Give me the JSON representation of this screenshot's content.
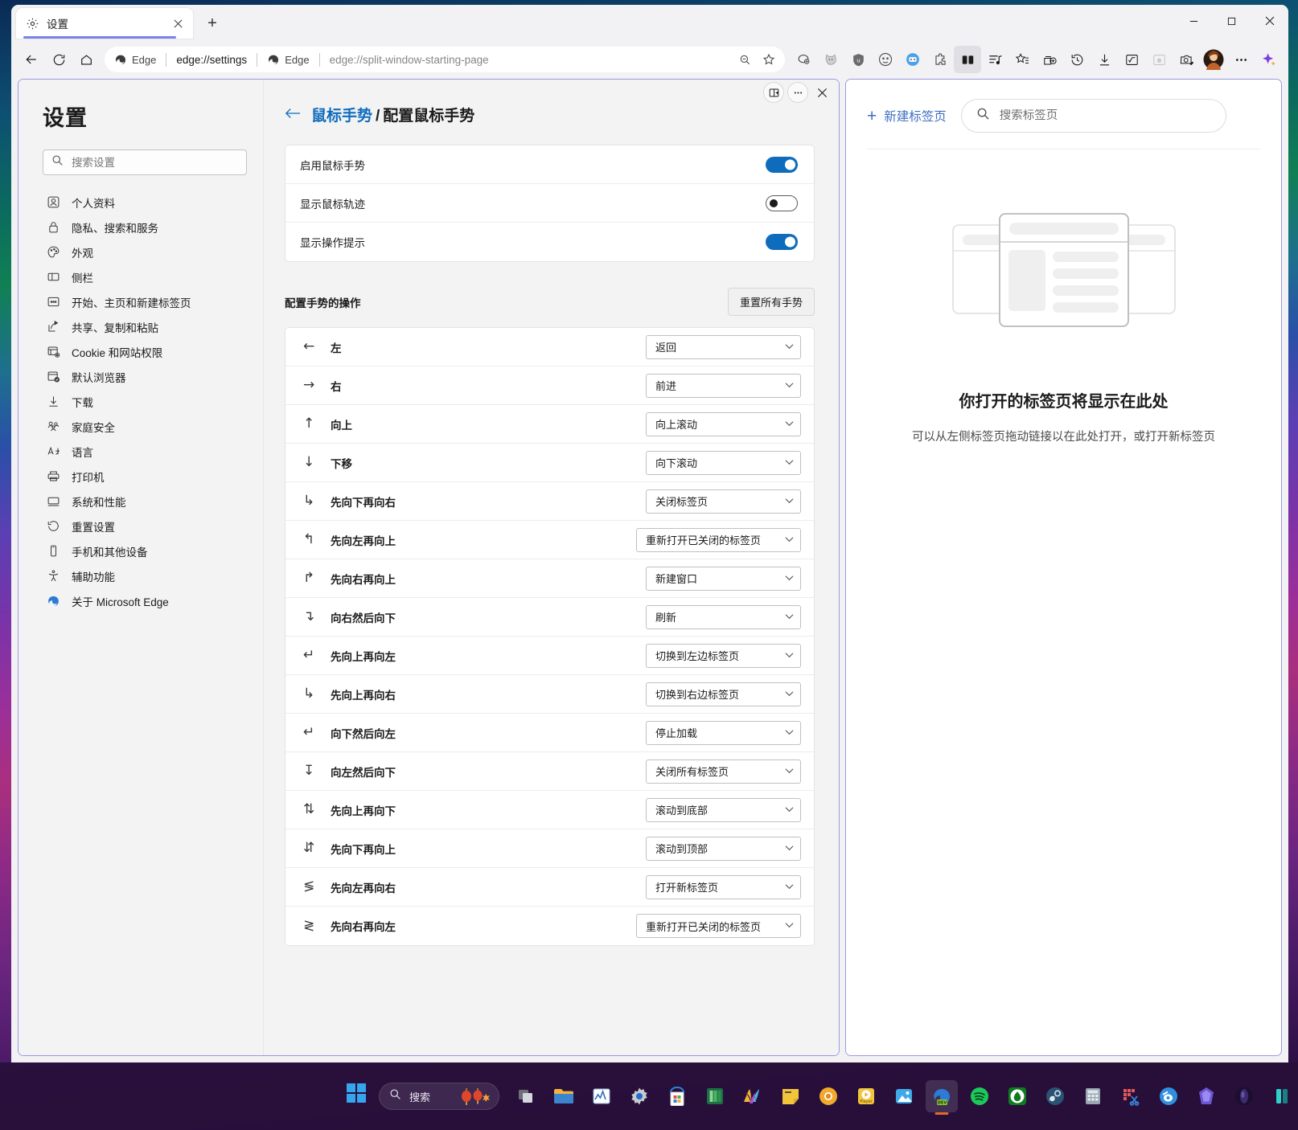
{
  "browser": {
    "tab": {
      "title": "设置",
      "favicon_icon": "gear-icon",
      "close_icon": "close-icon"
    },
    "new_tab_icon": "plus-icon",
    "window_controls": {
      "minimize": "minimize-icon",
      "maximize": "maximize-icon",
      "close": "close-icon"
    },
    "nav": {
      "back_icon": "back-arrow-icon",
      "refresh_icon": "refresh-icon",
      "home_icon": "home-icon"
    },
    "address": {
      "left_badge": "Edge",
      "left_url": "edge://settings",
      "right_badge": "Edge",
      "right_url": "edge://split-window-starting-page",
      "zoom_icon": "zoom-out-icon",
      "favorite_icon": "star-add-icon"
    },
    "toolbar_icons": [
      "copilot-badge-icon",
      "cat-extension-icon",
      "ublock-origin-icon",
      "monkey-extension-icon",
      "blue-robot-extension-icon",
      "puzzle-extensions-icon",
      "split-screen-icon",
      "playlist-icon",
      "collections-star-icon",
      "add-tab-group-icon",
      "history-icon",
      "downloads-icon",
      "math-solver-icon",
      "ie-mode-icon",
      "screenshot-icon",
      "profile-avatar",
      "more-settings-icon",
      "copilot-sparkle-icon"
    ]
  },
  "split_controls": {
    "layout_icon": "split-layout-icon",
    "more_icon": "more-dots-icon",
    "close_icon": "close-icon"
  },
  "settings": {
    "heading": "设置",
    "search": {
      "placeholder": "搜索设置",
      "value": "",
      "icon": "search-icon"
    },
    "nav_items": [
      {
        "label": "个人资料",
        "icon": "profile-icon"
      },
      {
        "label": "隐私、搜索和服务",
        "icon": "lock-icon"
      },
      {
        "label": "外观",
        "icon": "palette-icon"
      },
      {
        "label": "侧栏",
        "icon": "sidebar-icon"
      },
      {
        "label": "开始、主页和新建标签页",
        "icon": "home-page-icon"
      },
      {
        "label": "共享、复制和粘贴",
        "icon": "share-icon"
      },
      {
        "label": "Cookie 和网站权限",
        "icon": "cookie-permissions-icon"
      },
      {
        "label": "默认浏览器",
        "icon": "default-browser-icon"
      },
      {
        "label": "下载",
        "icon": "download-icon"
      },
      {
        "label": "家庭安全",
        "icon": "family-icon"
      },
      {
        "label": "语言",
        "icon": "language-icon"
      },
      {
        "label": "打印机",
        "icon": "printer-icon"
      },
      {
        "label": "系统和性能",
        "icon": "system-icon"
      },
      {
        "label": "重置设置",
        "icon": "reset-icon"
      },
      {
        "label": "手机和其他设备",
        "icon": "phone-icon"
      },
      {
        "label": "辅助功能",
        "icon": "accessibility-icon"
      },
      {
        "label": "关于 Microsoft Edge",
        "icon": "edge-logo-icon"
      }
    ],
    "breadcrumb": {
      "back_icon": "back-arrow-icon",
      "parent": "鼠标手势",
      "separator": "/",
      "current": "配置鼠标手势"
    },
    "toggles": [
      {
        "label": "启用鼠标手势",
        "state": "on"
      },
      {
        "label": "显示鼠标轨迹",
        "state": "off"
      },
      {
        "label": "显示操作提示",
        "state": "on"
      }
    ],
    "gestures_section": {
      "title": "配置手势的操作",
      "reset_button": "重置所有手势"
    },
    "gestures": [
      {
        "glyph": "←",
        "name": "左",
        "action": "返回"
      },
      {
        "glyph": "→",
        "name": "右",
        "action": "前进"
      },
      {
        "glyph": "↑",
        "name": "向上",
        "action": "向上滚动"
      },
      {
        "glyph": "↓",
        "name": "下移",
        "action": "向下滚动"
      },
      {
        "glyph": "↳",
        "name": "先向下再向右",
        "action": "关闭标签页"
      },
      {
        "glyph": "↰",
        "name": "先向左再向上",
        "action": "重新打开已关闭的标签页"
      },
      {
        "glyph": "↱",
        "name": "先向右再向上",
        "action": "新建窗口"
      },
      {
        "glyph": "↴",
        "name": "向右然后向下",
        "action": "刷新"
      },
      {
        "glyph": "↵",
        "name": "先向上再向左",
        "action": "切换到左边标签页"
      },
      {
        "glyph": "↳",
        "name": "先向上再向右",
        "action": "切换到右边标签页"
      },
      {
        "glyph": "↵",
        "name": "向下然后向左",
        "action": "停止加载"
      },
      {
        "glyph": "↧",
        "name": "向左然后向下",
        "action": "关闭所有标签页"
      },
      {
        "glyph": "⇅",
        "name": "先向上再向下",
        "action": "滚动到底部"
      },
      {
        "glyph": "⇵",
        "name": "先向下再向上",
        "action": "滚动到顶部"
      },
      {
        "glyph": "≶",
        "name": "先向左再向右",
        "action": "打开新标签页"
      },
      {
        "glyph": "≷",
        "name": "先向右再向左",
        "action": "重新打开已关闭的标签页"
      }
    ]
  },
  "split_page": {
    "new_tab_label": "新建标签页",
    "new_tab_icon": "plus-icon",
    "search": {
      "placeholder": "搜索标签页",
      "value": "",
      "icon": "search-icon"
    },
    "illustration_icon": "browser-windows-illustration",
    "title": "你打开的标签页将显示在此处",
    "subtitle": "可以从左侧标签页拖动链接以在此处打开，或打开新标签页"
  },
  "taskbar": {
    "start_icon": "windows-start-icon",
    "search": {
      "label": "搜索",
      "icon": "search-icon",
      "decoration": "lanterns-icon"
    },
    "apps": [
      {
        "icon": "task-view-icon"
      },
      {
        "icon": "file-explorer-icon"
      },
      {
        "icon": "performance-monitor-icon"
      },
      {
        "icon": "settings-gear-icon"
      },
      {
        "icon": "microsoft-store-icon"
      },
      {
        "icon": "excel-icon"
      },
      {
        "icon": "windows-mail-icon"
      },
      {
        "icon": "sticky-notes-icon"
      },
      {
        "icon": "chrome-icon"
      },
      {
        "icon": "media-player-icon"
      },
      {
        "icon": "photos-icon"
      },
      {
        "icon": "edge-dev-icon",
        "selected": true
      },
      {
        "icon": "spotify-icon"
      },
      {
        "icon": "xbox-icon"
      },
      {
        "icon": "steam-icon"
      },
      {
        "icon": "calculator-icon"
      },
      {
        "icon": "snipping-tool-icon"
      },
      {
        "icon": "blender-icon"
      },
      {
        "icon": "obsidian-icon"
      },
      {
        "icon": "dark-orb-icon"
      },
      {
        "icon": "teal-app-icon"
      }
    ]
  }
}
